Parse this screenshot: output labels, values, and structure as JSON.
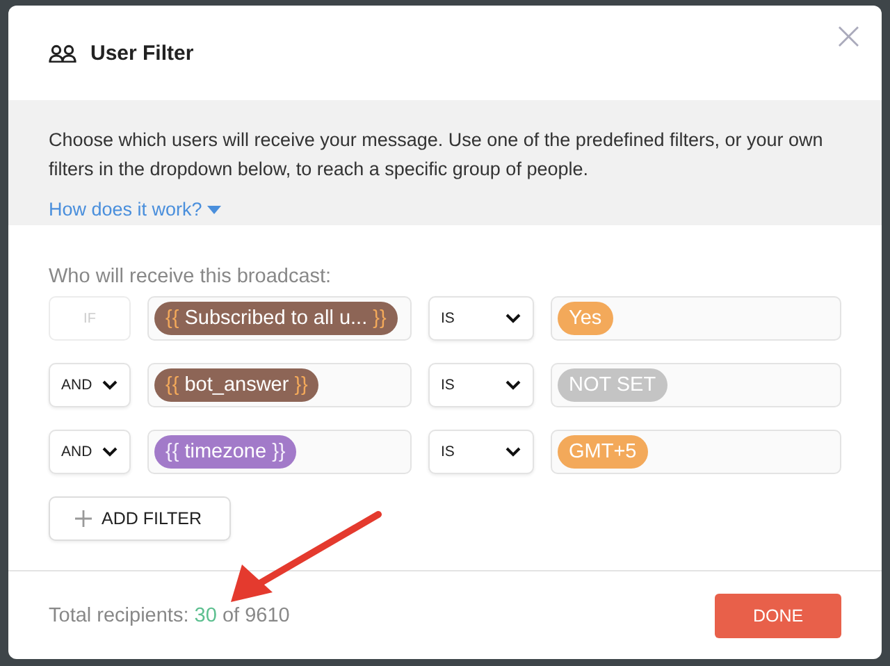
{
  "dialog": {
    "title": "User Filter",
    "close": "×"
  },
  "intro": {
    "text": "Choose which users will receive your message. Use one of the predefined filters, or your own filters in the dropdown below, to reach a specific group of people.",
    "link": "How does it work?"
  },
  "filters_label": "Who will receive this broadcast:",
  "filters": [
    {
      "connector": {
        "kind": "static",
        "label": "IF"
      },
      "variable": {
        "open": "{{",
        "name": "Subscribed to all u...",
        "close": "}}",
        "color": "#8d6556",
        "kind": "attribute"
      },
      "operator": "IS",
      "value": {
        "label": "Yes",
        "color": "#f3a95a"
      }
    },
    {
      "connector": {
        "kind": "dropdown",
        "label": "AND"
      },
      "variable": {
        "open": "{{",
        "name": "bot_answer",
        "close": "}}",
        "color": "#8d6556",
        "kind": "attribute"
      },
      "operator": "IS",
      "value": {
        "label": "NOT SET",
        "color": "#c4c4c4"
      }
    },
    {
      "connector": {
        "kind": "dropdown",
        "label": "AND"
      },
      "variable": {
        "open": "{{",
        "name": "timezone",
        "close": "}}",
        "color": "#a27ac9",
        "kind": "system"
      },
      "operator": "IS",
      "value": {
        "label": "GMT+5",
        "color": "#f3a95a"
      }
    }
  ],
  "add_filter": "ADD FILTER",
  "footer": {
    "label": "Total recipients:",
    "count": "30",
    "of": "of 9610",
    "done": "DONE"
  }
}
